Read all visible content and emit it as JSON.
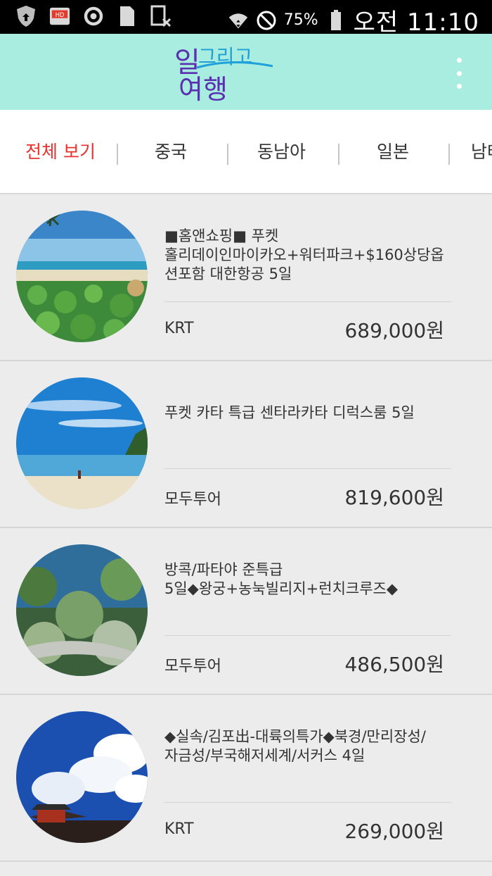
{
  "status_bar": {
    "battery_text": "75%",
    "time": "오전 11:10",
    "icons": [
      "shield-icon",
      "hd-icon",
      "settings-icon",
      "sim-icon",
      "blocked-app-icon",
      "wifi-icon",
      "do-not-disturb-icon",
      "battery-icon"
    ]
  },
  "app_bar": {
    "logo_top": "그리고",
    "logo_left": "일",
    "logo_bottom": "여행",
    "brand_colors": {
      "teal_bg": "#a9ece0",
      "logo_blue": "#1da1d8",
      "logo_purple": "#5a2fb0"
    }
  },
  "tabs": [
    {
      "label": "전체 보기",
      "active": true
    },
    {
      "label": "중국",
      "active": false
    },
    {
      "label": "동남아",
      "active": false
    },
    {
      "label": "일본",
      "active": false
    },
    {
      "label": "남태",
      "active": false
    }
  ],
  "accent_color": "#e8322f",
  "items": [
    {
      "title_lines": [
        "■홈앤쇼핑■ 푸켓",
        "홀리데이인마이카오+워터파크+$160상당옵",
        "션포함 대한항공 5일"
      ],
      "agency": "KRT",
      "price": "689,000원",
      "image": "beach-with-plants"
    },
    {
      "title_lines": [
        "푸켓 카타 특급 센타라카타 디럭스룸 5일"
      ],
      "agency": "모두투어",
      "price": "819,600원",
      "image": "beach-blue-sky"
    },
    {
      "title_lines": [
        "방콕/파타야 준특급",
        "5일◆왕궁+농눅빌리지+런치크루즈◆"
      ],
      "agency": "모두투어",
      "price": "486,500원",
      "image": "tropical-garden"
    },
    {
      "title_lines": [
        "◆실속/김포出-대륙의특가◆북경/만리장성/",
        "자금성/부국해저세계/서커스 4일"
      ],
      "agency": "KRT",
      "price": "269,000원",
      "image": "great-wall-clouds"
    }
  ]
}
